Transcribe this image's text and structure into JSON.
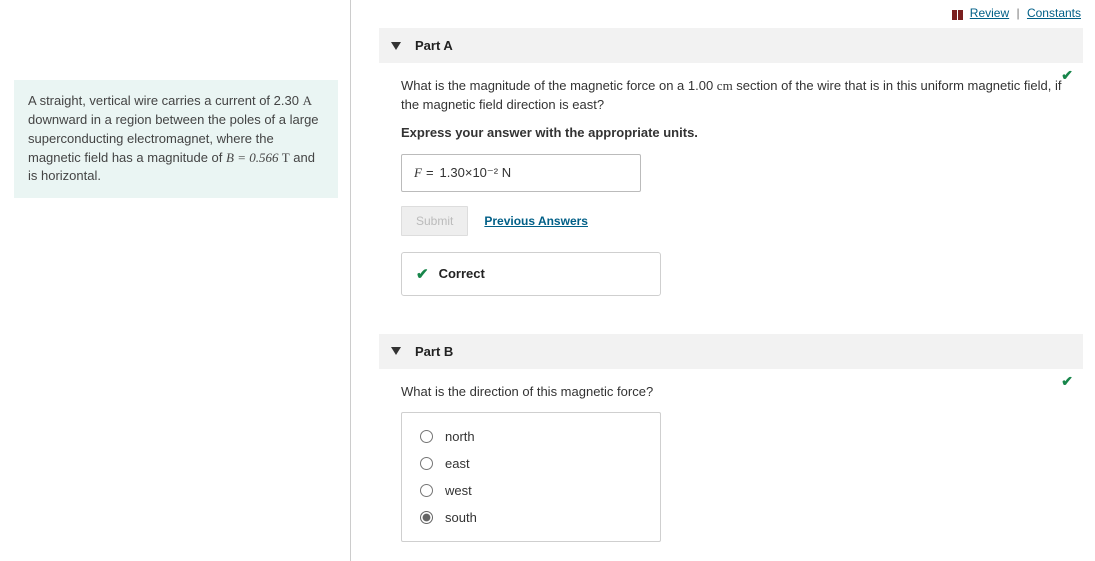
{
  "header": {
    "review": "Review",
    "constants": "Constants"
  },
  "problem": {
    "text_pre": "A straight, vertical wire carries a current of 2.30 ",
    "unit_A": "A",
    "text_mid": " downward in a region between the poles of a large superconducting electromagnet, where the magnetic field has a magnitude of ",
    "B_eq": "B = 0.566 ",
    "unit_T": "T",
    "text_post": " and is horizontal."
  },
  "partA": {
    "label": "Part A",
    "question_pre": "What is the magnitude of the magnetic force on a 1.00 ",
    "unit_cm": "cm",
    "question_post": " section of the wire that is in this uniform magnetic field, if the magnetic field direction is east?",
    "instruction": "Express your answer with the appropriate units.",
    "answer_symbol": "F",
    "answer_eq": "=",
    "answer_value": "1.30×10⁻² N",
    "submit": "Submit",
    "prev": "Previous Answers",
    "feedback": "Correct"
  },
  "partB": {
    "label": "Part B",
    "question": "What is the direction of this magnetic force?",
    "options": [
      "north",
      "east",
      "west",
      "south"
    ],
    "selected": "south"
  }
}
